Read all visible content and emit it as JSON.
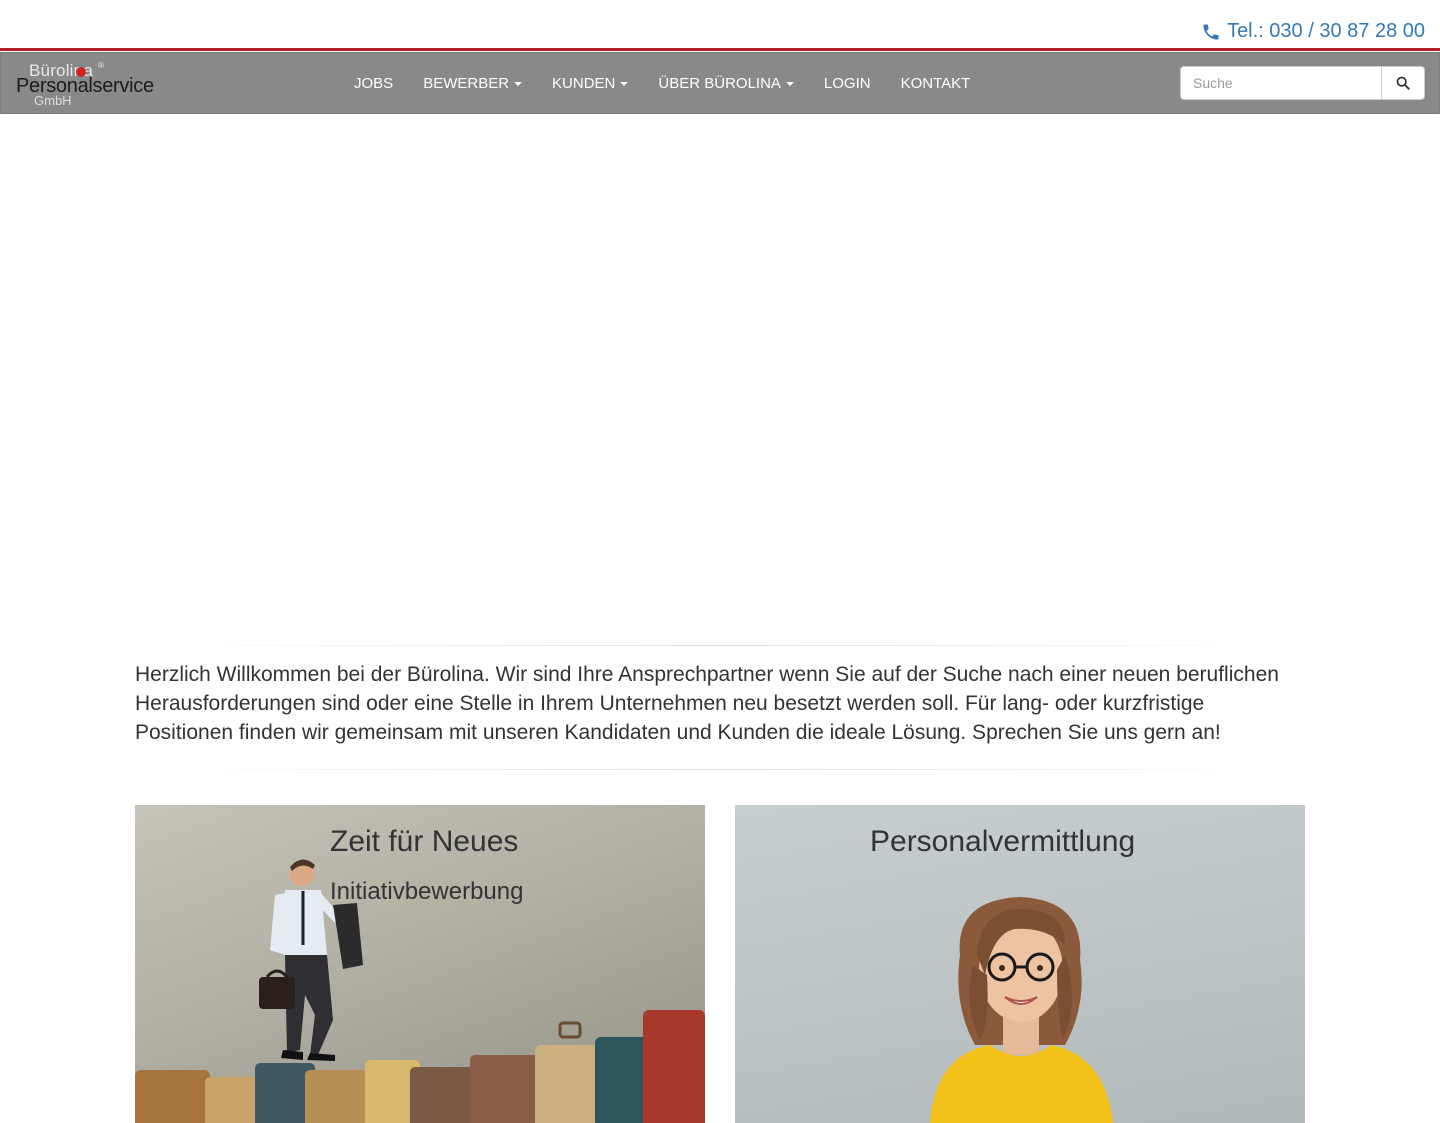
{
  "header": {
    "phone": "Tel.: 030 / 30 87 28 00",
    "phone_icon": "phone-icon",
    "accent_color": "#337ab7",
    "line_color": "#b21f2d"
  },
  "logo": {
    "line1": "Bürolina",
    "registered": "®",
    "line2": "Personalservice",
    "line3": "GmbH"
  },
  "nav": {
    "items": [
      {
        "label": "JOBS",
        "dropdown": false
      },
      {
        "label": "BEWERBER",
        "dropdown": true
      },
      {
        "label": "KUNDEN",
        "dropdown": true
      },
      {
        "label": "ÜBER BÜROLINA",
        "dropdown": true
      },
      {
        "label": "LOGIN",
        "dropdown": false
      },
      {
        "label": "KONTAKT",
        "dropdown": false
      }
    ],
    "background": "#898989"
  },
  "search": {
    "placeholder": "Suche",
    "value": "",
    "icon": "search-icon"
  },
  "welcome": {
    "text": "Herzlich Willkommen bei der Bürolina. Wir sind Ihre Ansprechpartner wenn Sie auf der Suche nach einer neuen beruflichen Herausforderungen sind oder eine Stelle in Ihrem Unternehmen neu besetzt werden soll. Für lang- oder kurzfristige Positionen finden wir gemeinsam mit unseren Kandidaten und Kunden die ideale Lösung. Sprechen Sie uns gern an!"
  },
  "cards": [
    {
      "title": "Zeit für Neues",
      "subtitle": "Initiativbewerbung",
      "image": "businessman-on-suitcases"
    },
    {
      "title": "Personalvermittlung",
      "subtitle": "",
      "image": "smiling-woman-yellow-shirt"
    }
  ]
}
